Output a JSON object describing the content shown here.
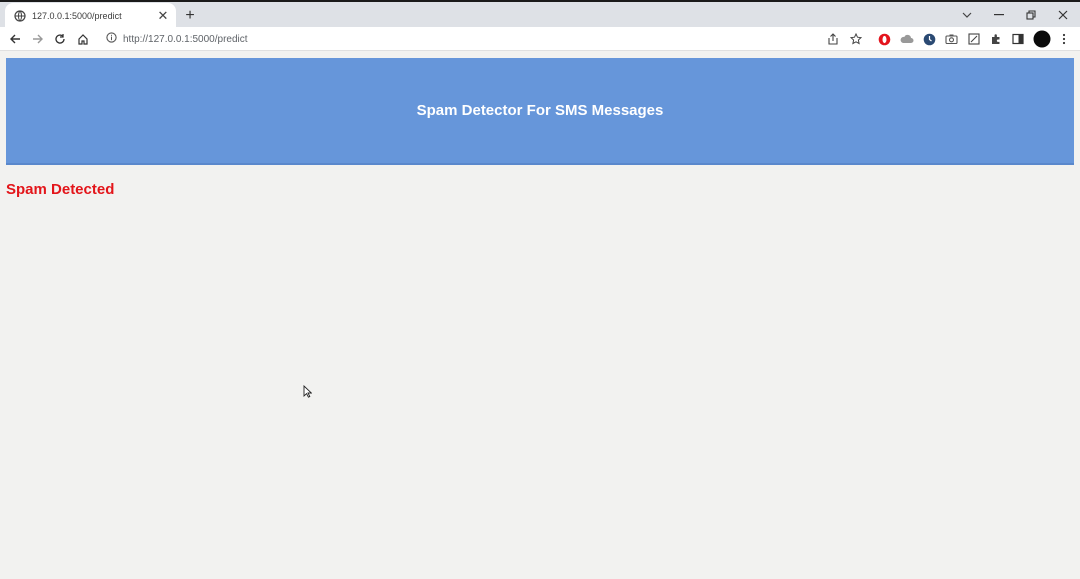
{
  "browser": {
    "tab_title": "127.0.0.1:5000/predict",
    "new_tab_symbol": "+",
    "url": "http://127.0.0.1:5000/predict",
    "icons": [
      "globe-icon",
      "close-icon",
      "back-icon",
      "forward-icon",
      "reload-icon",
      "home-icon",
      "info-icon",
      "share-icon",
      "star-icon",
      "opera-icon",
      "cloud-icon",
      "clock-icon",
      "camera-icon",
      "screenshot-icon",
      "extensions-icon",
      "sidepanel-icon",
      "profile-avatar",
      "menu-icon"
    ]
  },
  "page": {
    "header_title": "Spam Detector For SMS Messages",
    "result_text": "Spam Detected",
    "colors": {
      "header_bg": "#6696da",
      "result_text": "#e3151a",
      "page_bg": "#f2f2f0"
    }
  }
}
